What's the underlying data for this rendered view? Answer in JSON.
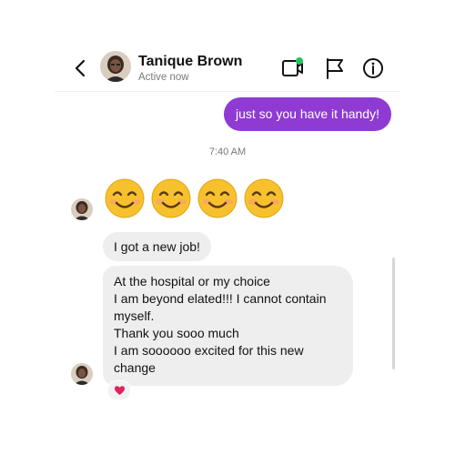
{
  "header": {
    "contact_name": "Tanique Brown",
    "status": "Active now",
    "back_icon": "chevron-left-icon",
    "video_icon": "video-call-icon",
    "flag_icon": "flag-icon",
    "info_icon": "info-icon",
    "online_indicator_color": "#22c55e"
  },
  "messages": {
    "outgoing_text": "just so you have it handy!",
    "timestamp": "7:40 AM",
    "emoji_count": 4,
    "incoming_1": "I got a new job!",
    "incoming_2_lines": [
      "At the hospital or my choice",
      "I am beyond elated!!! I cannot contain",
      "myself.",
      "Thank you sooo much",
      "I am soooooo excited for this new",
      "change"
    ],
    "reaction_icon": "heart-icon"
  },
  "colors": {
    "outgoing_bubble": "#8f3ad3",
    "incoming_bubble": "#eeeeee",
    "heart": "#e0245e"
  }
}
